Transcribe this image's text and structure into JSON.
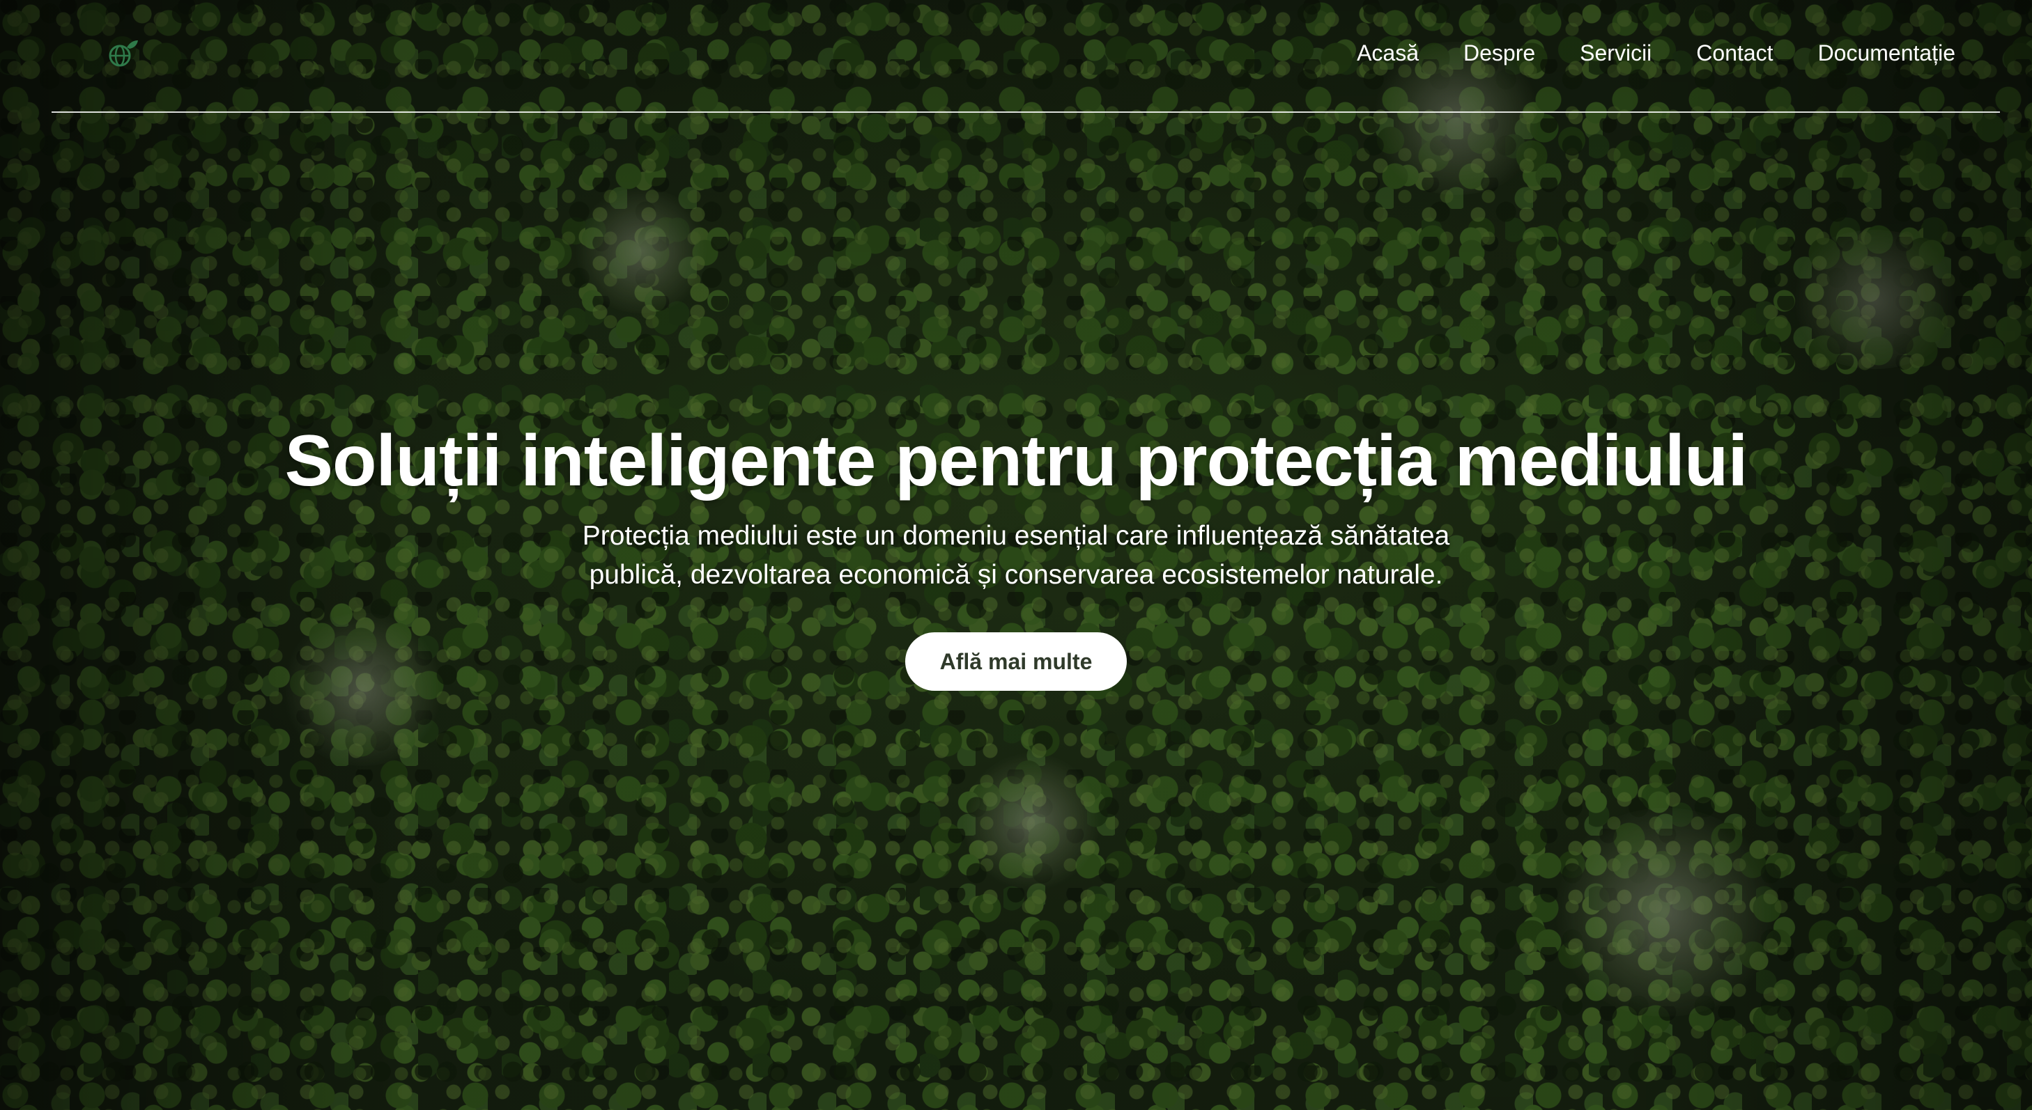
{
  "nav": {
    "logo_icon": "eco-globe-icon",
    "links": [
      {
        "label": "Acasă"
      },
      {
        "label": "Despre"
      },
      {
        "label": "Servicii"
      },
      {
        "label": "Contact"
      },
      {
        "label": "Documentație"
      }
    ]
  },
  "hero": {
    "title": "Soluții inteligente pentru protecția mediului",
    "subtitle": "Protecția mediului este un domeniu esențial care influențează sănătatea publică, dezvoltarea economică și conservarea ecosistemelor naturale.",
    "cta_label": "Află mai multe"
  },
  "colors": {
    "accent": "#2f7a4a",
    "cta_background": "#ffffff",
    "cta_text": "#2f3a2a",
    "text": "#ffffff"
  }
}
